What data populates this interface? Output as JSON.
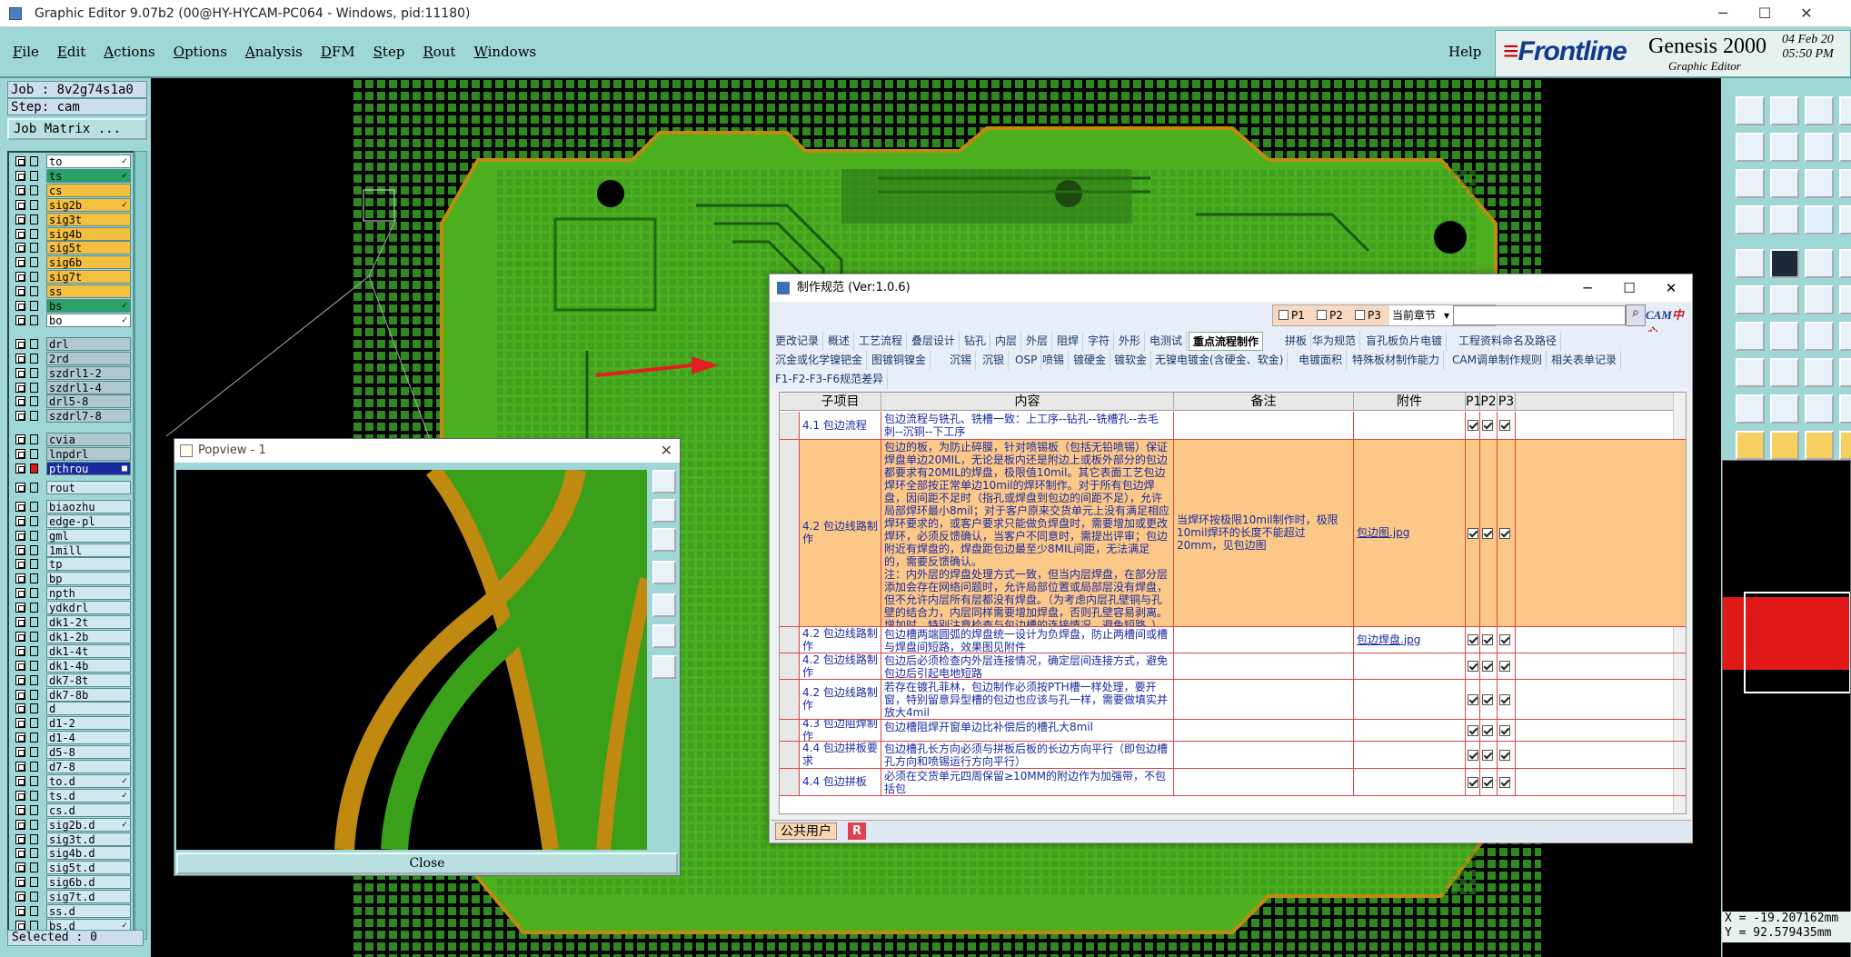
{
  "window": {
    "title": "Graphic Editor 9.07b2 (00@HY-HYCAM-PC064 - Windows, pid:11180)",
    "minimize": "─",
    "maximize": "☐",
    "close": "✕"
  },
  "menu": [
    "File",
    "Edit",
    "Actions",
    "Options",
    "Analysis",
    "DFM",
    "Step",
    "Rout",
    "Windows"
  ],
  "help": "Help",
  "brand": {
    "logo": "Frontline",
    "product": "Genesis 2000",
    "subtitle": "Graphic Editor",
    "date": "04 Feb 20",
    "time": "05:50 PM"
  },
  "job": {
    "job_line": "Job : 8v2g74s1a0",
    "step_line": "Step: cam",
    "matrix_button": "Job Matrix ..."
  },
  "layers": [
    {
      "name": "to",
      "color": "#ffffff",
      "mark": "✓"
    },
    {
      "name": "ts",
      "color": "#2aa06a",
      "mark": "✓"
    },
    {
      "name": "cs",
      "color": "#f5c040",
      "mark": ""
    },
    {
      "name": "sig2b",
      "color": "#f5c040",
      "mark": "✓"
    },
    {
      "name": "sig3t",
      "color": "#f5c040",
      "mark": ""
    },
    {
      "name": "sig4b",
      "color": "#f5c040",
      "mark": ""
    },
    {
      "name": "sig5t",
      "color": "#f5c040",
      "mark": ""
    },
    {
      "name": "sig6b",
      "color": "#f5c040",
      "mark": ""
    },
    {
      "name": "sig7t",
      "color": "#f5c040",
      "mark": ""
    },
    {
      "name": "ss",
      "color": "#f5c040",
      "mark": ""
    },
    {
      "name": "bs",
      "color": "#2aa06a",
      "mark": "✓"
    },
    {
      "name": "bo",
      "color": "#ffffff",
      "mark": "✓"
    },
    {
      "name": "drl",
      "color": "#b0c8d0",
      "mark": ""
    },
    {
      "name": "2rd",
      "color": "#b0c8d0",
      "mark": ""
    },
    {
      "name": "szdrl1-2",
      "color": "#b0c8d0",
      "mark": ""
    },
    {
      "name": "szdrl1-4",
      "color": "#b0c8d0",
      "mark": ""
    },
    {
      "name": "drl5-8",
      "color": "#b0c8d0",
      "mark": ""
    },
    {
      "name": "szdrl7-8",
      "color": "#b0c8d0",
      "mark": ""
    },
    {
      "name": "cvia",
      "color": "#b0c8d0",
      "mark": ""
    },
    {
      "name": "lnpdrl",
      "color": "#b0c8d0",
      "mark": ""
    },
    {
      "name": "pthrou",
      "color": "#1a2aa0",
      "mark": "■"
    },
    {
      "name": "rout",
      "color": "#d0e8f0",
      "mark": ""
    },
    {
      "name": "biaozhu",
      "color": "#d0e8f0",
      "mark": ""
    },
    {
      "name": "edge-pl",
      "color": "#d0e8f0",
      "mark": ""
    },
    {
      "name": "gml",
      "color": "#d0e8f0",
      "mark": ""
    },
    {
      "name": "1mill",
      "color": "#d0e8f0",
      "mark": ""
    },
    {
      "name": "tp",
      "color": "#d0e8f0",
      "mark": ""
    },
    {
      "name": "bp",
      "color": "#d0e8f0",
      "mark": ""
    },
    {
      "name": "npth",
      "color": "#d0e8f0",
      "mark": ""
    },
    {
      "name": "ydkdrl",
      "color": "#d0e8f0",
      "mark": ""
    },
    {
      "name": "dk1-2t",
      "color": "#d0e8f0",
      "mark": ""
    },
    {
      "name": "dk1-2b",
      "color": "#d0e8f0",
      "mark": ""
    },
    {
      "name": "dk1-4t",
      "color": "#d0e8f0",
      "mark": ""
    },
    {
      "name": "dk1-4b",
      "color": "#d0e8f0",
      "mark": ""
    },
    {
      "name": "dk7-8t",
      "color": "#d0e8f0",
      "mark": ""
    },
    {
      "name": "dk7-8b",
      "color": "#d0e8f0",
      "mark": ""
    },
    {
      "name": "d",
      "color": "#d0e8f0",
      "mark": ""
    },
    {
      "name": "d1-2",
      "color": "#d0e8f0",
      "mark": ""
    },
    {
      "name": "d1-4",
      "color": "#d0e8f0",
      "mark": ""
    },
    {
      "name": "d5-8",
      "color": "#d0e8f0",
      "mark": ""
    },
    {
      "name": "d7-8",
      "color": "#d0e8f0",
      "mark": ""
    },
    {
      "name": "to.d",
      "color": "#d0e8f0",
      "mark": "✓"
    },
    {
      "name": "ts.d",
      "color": "#d0e8f0",
      "mark": "✓"
    },
    {
      "name": "cs.d",
      "color": "#d0e8f0",
      "mark": ""
    },
    {
      "name": "sig2b.d",
      "color": "#d0e8f0",
      "mark": "✓"
    },
    {
      "name": "sig3t.d",
      "color": "#d0e8f0",
      "mark": ""
    },
    {
      "name": "sig4b.d",
      "color": "#d0e8f0",
      "mark": ""
    },
    {
      "name": "sig5t.d",
      "color": "#d0e8f0",
      "mark": ""
    },
    {
      "name": "sig6b.d",
      "color": "#d0e8f0",
      "mark": ""
    },
    {
      "name": "sig7t.d",
      "color": "#d0e8f0",
      "mark": ""
    },
    {
      "name": "ss.d",
      "color": "#d0e8f0",
      "mark": ""
    },
    {
      "name": "bs.d",
      "color": "#d0e8f0",
      "mark": "✓"
    }
  ],
  "selected": "Selected : 0",
  "coords": {
    "x": "X = -19.207162mm",
    "y": "Y = 92.579435mm"
  },
  "popview": {
    "title": "Popview - 1",
    "close_label": "Close",
    "close_x": "✕"
  },
  "dialog": {
    "title": "制作规范 (Ver:1.0.6)",
    "minimize": "─",
    "maximize": "☐",
    "close": "✕",
    "filters": {
      "p1": "P1",
      "p2": "P2",
      "p3": "P3",
      "chapter": "当前章节"
    },
    "search_placeholder": "",
    "cam_logo": "CAM",
    "cam_logo_red": "中心",
    "tabs_row1": [
      "更改记录",
      "概述",
      "工艺流程",
      "叠层设计",
      "钻孔",
      "内层",
      "外层",
      "阻焊",
      "字符",
      "外形",
      "电测试",
      "重点流程制作",
      "拼板",
      "华为规范",
      "盲孔板负片电镀",
      "工程资料命名及路径"
    ],
    "tabs_row2": [
      "沉金或化学镍钯金",
      "图镀铜镍金",
      "沉锡",
      "沉银",
      "OSP",
      "喷锡",
      "镀硬金",
      "镀软金",
      "无镍电镀金(含硬金、软金)",
      "电镀面积",
      "特殊板材制作能力",
      "CAM调单制作规则",
      "相关表单记录"
    ],
    "tabs_row3": [
      "F1-F2-F3-F6规范差异"
    ],
    "active_tab": "重点流程制作",
    "columns": [
      "子项目",
      "内容",
      "备注",
      "附件",
      "P1",
      "P2",
      "P3"
    ],
    "rows": [
      {
        "sub": "4.1 包边流程",
        "content": "包边流程与铣孔、铣槽一致：上工序--钻孔--铣槽孔--去毛刺--沉铜--下工序",
        "note": "",
        "att": "",
        "hl": false
      },
      {
        "sub": "4.2 包边线路制作",
        "content": "包边的板，为防止碎膜，针对喷锡板（包括无铅喷锡）保证焊盘单边20MIL，无论是板内还是附边上或板外部分的包边都要求有20MIL的焊盘，极限值10mil。其它表面工艺包边焊环全部按正常单边10mil的焊环制作。对于所有包边焊盘，因间距不足时（指孔或焊盘到包边的间距不足），允许局部焊环最小8mil；对于客户原来交货单元上没有满足相应焊环要求的，或客户要求只能做负焊盘时，需要增加或更改焊环，必须反馈确认，当客户不同意时，需提出评审；包边附近有焊盘的，焊盘距包边最至少8MIL间距，无法满足的，需要反馈确认。\n注：内外层的焊盘处理方式一致，但当内层焊盘，在部分层添加会存在网络问题时，允许局部位置或局部层没有焊盘，但不允许内层所有层都没有焊盘。（为考虑内层孔壁铜与孔壁的结合力，内层同样需要增加焊盘，否则孔壁容易剥离。增加时，特别注意检查与包边槽的连接情况，避免短路。）",
        "note": "当焊环按极限10mil制作时，极限10mil焊环的长度不能超过20mm，见包边图",
        "att": "包边图.jpg",
        "hl": true
      },
      {
        "sub": "4.2 包边线路制作",
        "content": "包边槽两端圆弧的焊盘统一设计为负焊盘，防止两槽间或槽与焊盘间短路，效果图见附件",
        "note": "",
        "att": "包边焊盘.jpg",
        "hl": false
      },
      {
        "sub": "4.2 包边线路制作",
        "content": "包边后必须检查内外层连接情况，确定层间连接方式，避免包边后引起电地短路",
        "note": "",
        "att": "",
        "hl": false
      },
      {
        "sub": "4.2 包边线路制作",
        "content": "若存在镀孔菲林，包边制作必须按PTH槽一样处理，要开窗，特别留意异型槽的包边也应该与孔一样，需要做填实并放大4mil",
        "note": "",
        "att": "",
        "hl": false
      },
      {
        "sub": "4.3 包边阻焊制作",
        "content": "包边槽阻焊开窗单边比补偿后的槽孔大8mil",
        "note": "",
        "att": "",
        "hl": false
      },
      {
        "sub": "4.4 包边拼板要求",
        "content": "包边槽孔长方向必须与拼板后板的长边方向平行（即包边槽孔方向和喷锡运行方向平行）",
        "note": "",
        "att": "",
        "hl": false
      },
      {
        "sub": "4.4 包边拼板",
        "content": "必须在交货单元四周保留≥10MM的附边作为加强带，不包括包",
        "note": "",
        "att": "",
        "hl": false
      }
    ],
    "status_user": "公共用户",
    "status_r": "R"
  }
}
